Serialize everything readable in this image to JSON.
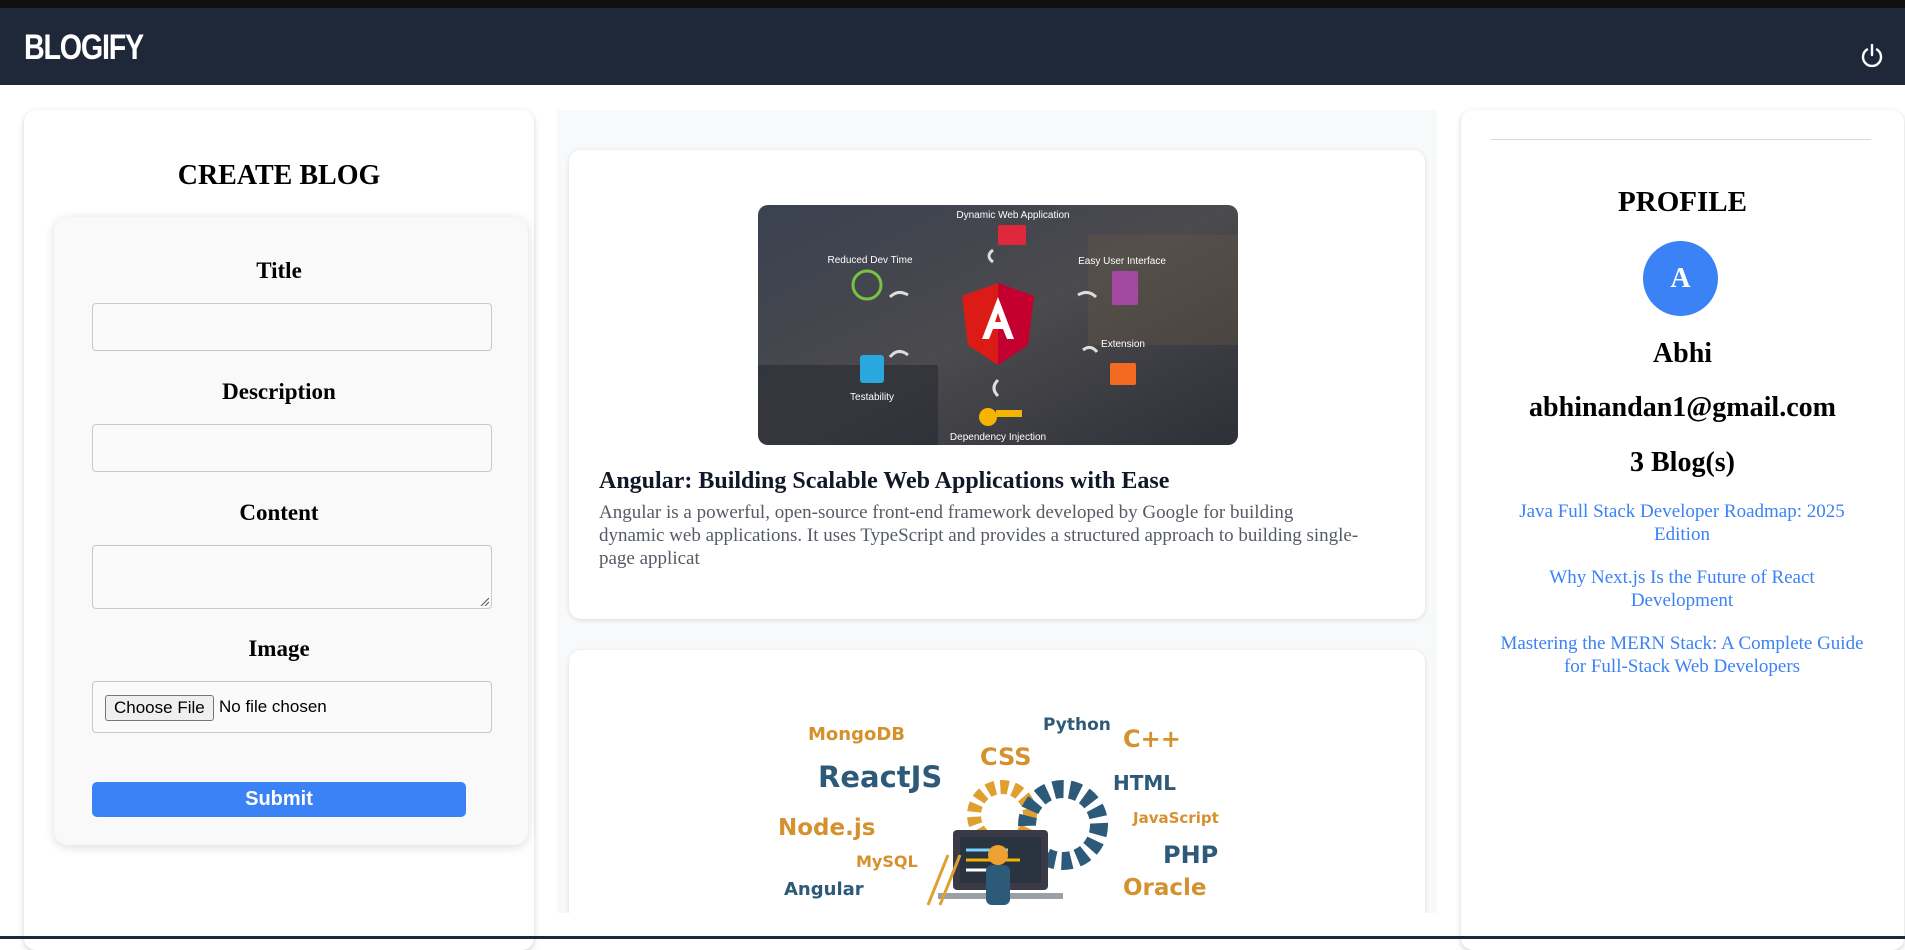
{
  "app": {
    "brand": "BLOGIFY"
  },
  "navbar": {
    "logout_icon": "power-icon"
  },
  "create_blog": {
    "heading": "CREATE BLOG",
    "fields": {
      "title_label": "Title",
      "title_value": "",
      "description_label": "Description",
      "description_value": "",
      "content_label": "Content",
      "content_value": "",
      "image_label": "Image",
      "choose_file_label": "Choose File",
      "file_status": "No file chosen"
    },
    "submit_label": "Submit"
  },
  "feed": {
    "posts": [
      {
        "title": "Angular: Building Scalable Web Applications with Ease",
        "description": "Angular is a powerful, open-source front-end framework developed by Google for building dynamic web applications. It uses TypeScript and provides a structured approach to building single-page applicat",
        "image": {
          "logo_letter": "A",
          "labels": [
            "Dynamic Web Application",
            "Reduced Dev Time",
            "Easy User Interface",
            "Extension",
            "Testability",
            "Dependency Injection"
          ]
        }
      },
      {
        "title": "",
        "description": "",
        "image": {
          "words": [
            "MongoDB",
            "Python",
            "C++",
            "CSS",
            "ReactJS",
            "HTML",
            "JavaScript",
            "Node.js",
            "MySQL",
            "PHP",
            "Angular",
            "Oracle"
          ]
        }
      }
    ]
  },
  "profile": {
    "heading": "PROFILE",
    "avatar_letter": "A",
    "name": "Abhi",
    "email": "abhinandan1@gmail.com",
    "blog_count": "3 Blog(s)",
    "blogs": [
      "Java Full Stack Developer Roadmap: 2025 Edition",
      "Why Next.js Is the Future of React Development",
      "Mastering the MERN Stack: A Complete Guide for Full-Stack Web Developers"
    ]
  },
  "colors": {
    "navbar": "#1f2838",
    "accent": "#3b82f6",
    "feed_background": "#f8f9fa"
  }
}
